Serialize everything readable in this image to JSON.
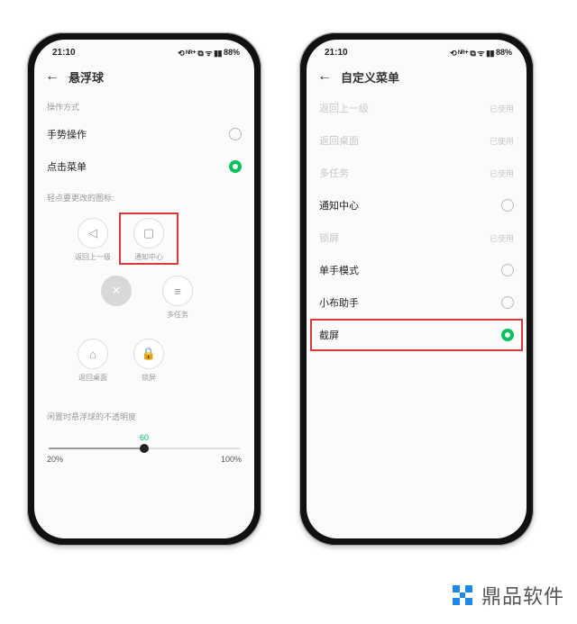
{
  "status": {
    "time": "21:10",
    "icons_text": "⟲ ᴺᴿ⁺ ⧉ ᯤ ▮▮",
    "battery_pct": "88%"
  },
  "phone_left": {
    "title": "悬浮球",
    "section_mode": "操作方式",
    "option_gesture": "手势操作",
    "option_tapmenu": "点击菜单",
    "section_icons": "轻点要更改的图标:",
    "icons": {
      "back": "返回上一级",
      "notify": "通知中心",
      "multitask": "多任务",
      "lock": "锁屏",
      "home": "返回桌面"
    },
    "slider": {
      "label": "闲置时悬浮球的不透明度",
      "value": "60",
      "min": "20%",
      "max": "100%",
      "pct": 50
    }
  },
  "phone_right": {
    "title": "自定义菜单",
    "used_hint": "已使用",
    "items": [
      {
        "label": "返回上一级",
        "state": "used"
      },
      {
        "label": "返回桌面",
        "state": "used"
      },
      {
        "label": "多任务",
        "state": "used"
      },
      {
        "label": "通知中心",
        "state": "open"
      },
      {
        "label": "锁屏",
        "state": "used"
      },
      {
        "label": "单手模式",
        "state": "open"
      },
      {
        "label": "小布助手",
        "state": "open"
      },
      {
        "label": "截屏",
        "state": "selected"
      }
    ]
  },
  "watermark": {
    "brand": "鼎品软件"
  }
}
